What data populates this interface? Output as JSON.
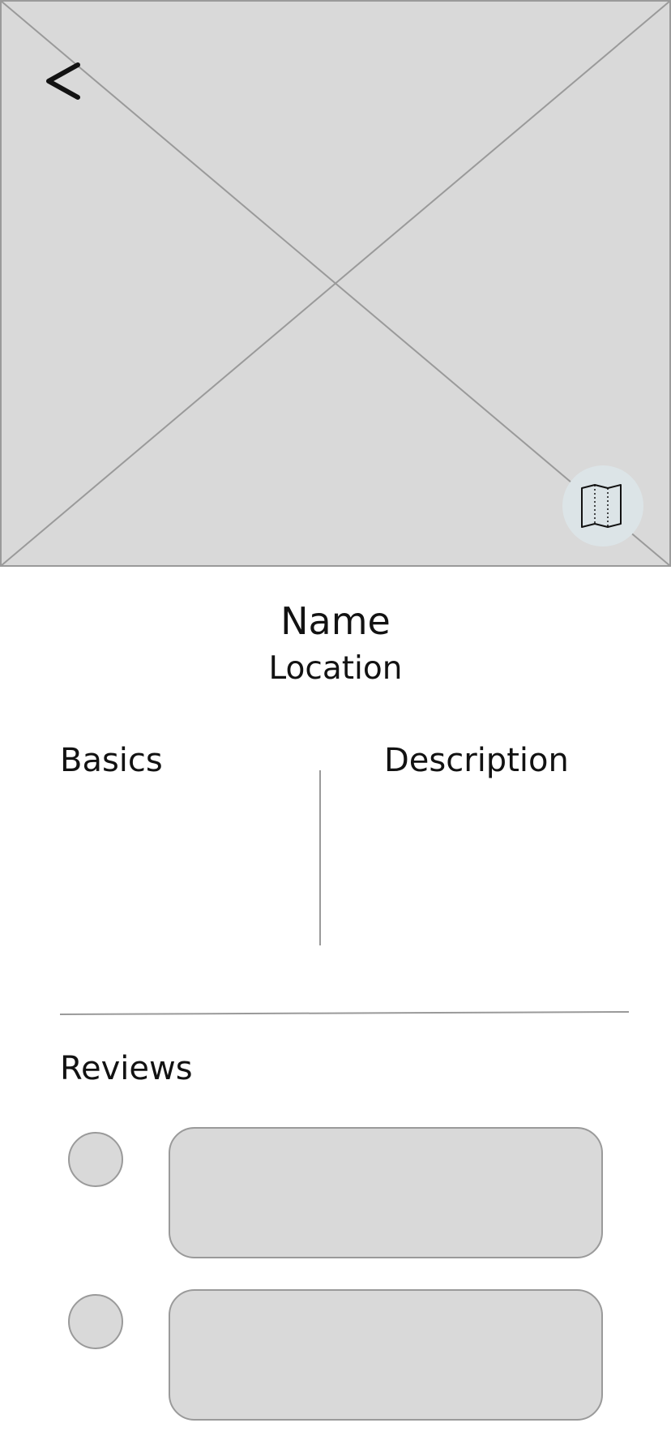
{
  "header": {
    "back_glyph": "<",
    "back_icon": "chevron-left-icon",
    "map_icon": "map-icon"
  },
  "place": {
    "name": "Name",
    "location": "Location"
  },
  "sections": {
    "basics": "Basics",
    "description": "Description",
    "reviews": "Reviews"
  },
  "reviews": [
    {},
    {}
  ],
  "colors": {
    "placeholder_fill": "#d9d9d9",
    "placeholder_stroke": "#9a9a9a",
    "map_button_bg": "#dce4e7",
    "text": "#121212"
  }
}
